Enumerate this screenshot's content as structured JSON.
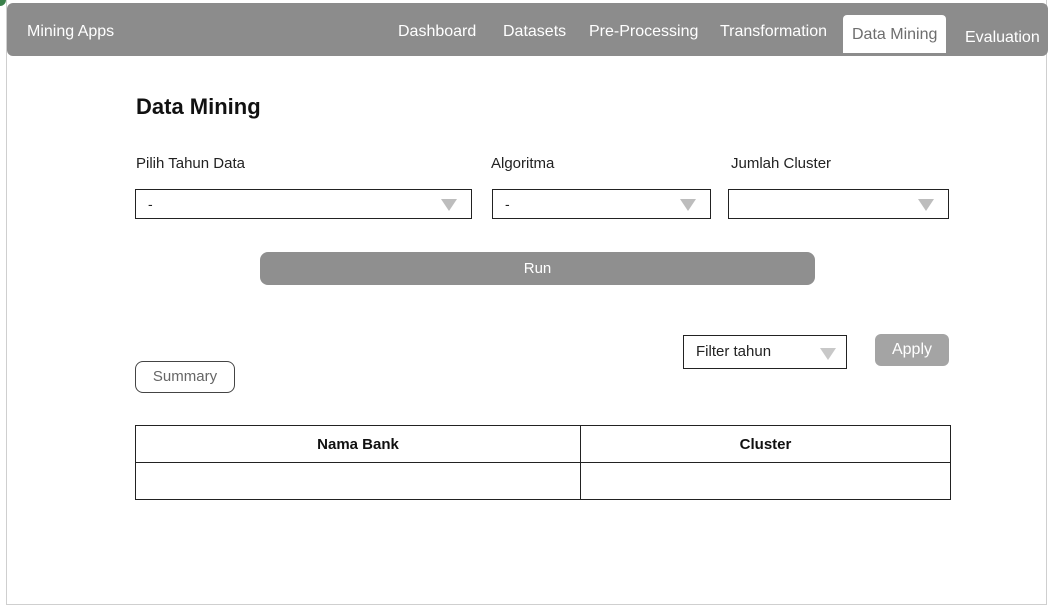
{
  "app": {
    "title": "Mining Apps"
  },
  "nav": {
    "items": [
      {
        "label": "Dashboard"
      },
      {
        "label": "Datasets"
      },
      {
        "label": "Pre-Processing"
      },
      {
        "label": "Transformation"
      },
      {
        "label": "Data Mining",
        "active": true
      },
      {
        "label": "Evaluation"
      }
    ]
  },
  "page": {
    "title": "Data Mining"
  },
  "form": {
    "year": {
      "label": "Pilih Tahun Data",
      "value": "-"
    },
    "algorithm": {
      "label": "Algoritma",
      "value": "-"
    },
    "clusters": {
      "label": "Jumlah Cluster",
      "value": ""
    },
    "run_label": "Run"
  },
  "filter": {
    "value": "Filter tahun",
    "apply_label": "Apply"
  },
  "summary_label": "Summary",
  "table": {
    "columns": [
      "Nama Bank",
      "Cluster"
    ],
    "rows": [
      [
        "",
        ""
      ]
    ]
  },
  "icons": {
    "dropdown": "caret-down-icon"
  },
  "colors": {
    "topbar": "#8c8c8c",
    "button": "#8f8f8f",
    "apply": "#a4a4a4"
  }
}
